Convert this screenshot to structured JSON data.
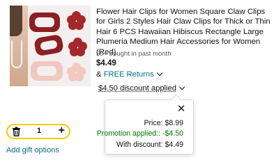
{
  "product": {
    "image_alt": "hair clips product image",
    "title": "Flower Hair Clips for Women Square Claw Clips for Girls 2 Styles Hair Claw Clips for Thick or Thin Hair 6 PCS Hawaiian Hibiscus Rectangle Large Plumeria Medium Hair Accessories for Women (Red)",
    "bought": "50+ bought in past month",
    "price": "$4.49",
    "returns_prefix": "& ",
    "returns_link": "FREE Returns",
    "discount_label": "$4.50 discount applied"
  },
  "popover": {
    "close_glyph": "✕",
    "price_line": "Price: $8.99",
    "promotion_line": "Promotion applied:: -$4.50",
    "with_discount_line": "With discount: $4.49"
  },
  "cart": {
    "quantity": "1",
    "plus_glyph": "+",
    "gift_link": "Add gift options"
  },
  "colors": {
    "link": "#007185",
    "promotion_green": "#007600",
    "stepper_border": "#f7ca00",
    "text": "#0f1111"
  },
  "icons": {
    "delete": "trash-icon",
    "add": "plus-icon",
    "close": "close-icon",
    "expand": "chevron-down-icon"
  }
}
